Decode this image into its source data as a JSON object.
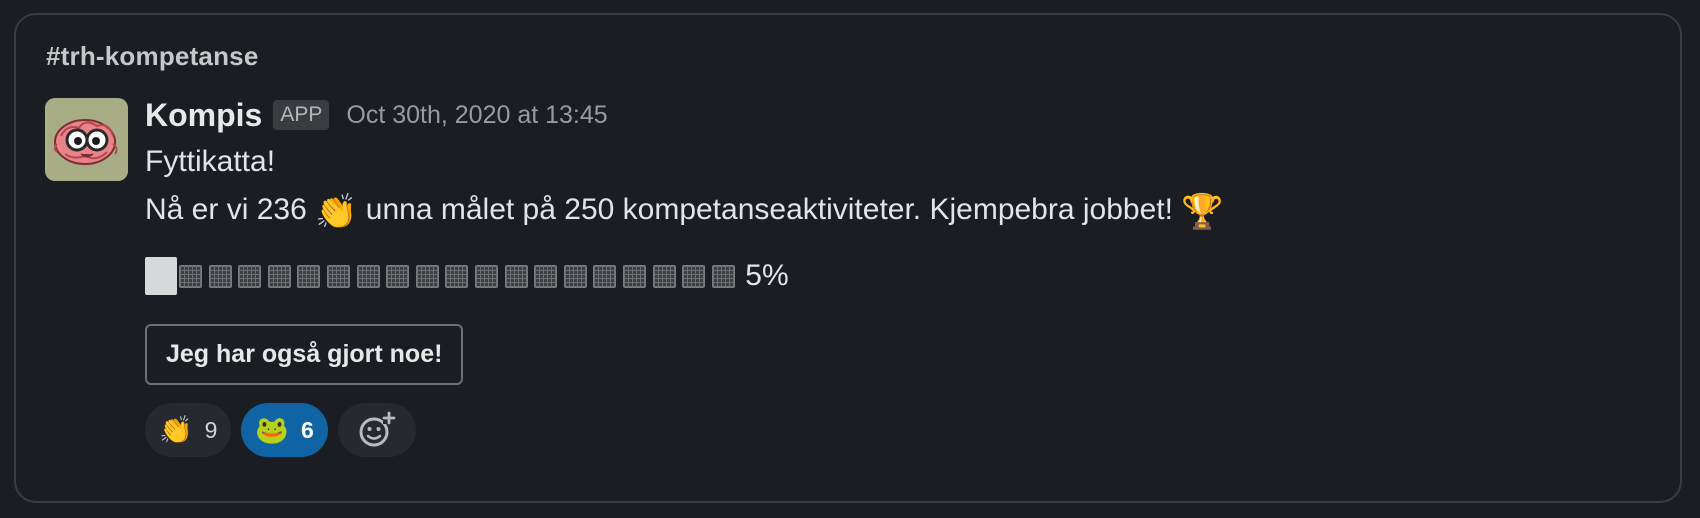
{
  "channel": "#trh-kompetanse",
  "message": {
    "sender": "Kompis",
    "badge": "APP",
    "timestamp": "Oct 30th, 2020 at 13:45",
    "line1": "Fyttikatta!",
    "line2_pre": "Nå er vi 236",
    "line2_emoji": "👏",
    "line2_post": "unna målet på 250 kompetanseaktiviteter. Kjempebra jobbet!",
    "line2_trophy": "🏆",
    "avatar_icon": "brain-with-glasses-icon"
  },
  "progress": {
    "percent_label": "5%",
    "value": 0.05,
    "filled_segments": 1,
    "empty_segments": 19
  },
  "action_button": {
    "label": "Jeg har også gjort noe!"
  },
  "reactions": [
    {
      "emoji": "👏",
      "icon": "clapping-hands-icon",
      "count": "9",
      "active": false
    },
    {
      "emoji": "🐸",
      "icon": "frog-icon",
      "count": "6",
      "active": true
    }
  ],
  "add_reaction_icon": "add-reaction-icon",
  "colors": {
    "background": "#1a1d21",
    "card_border": "#3b3d41",
    "active_reaction": "#1164a3",
    "avatar_bg": "#a9ad85",
    "brain_pink": "#e8838a"
  }
}
